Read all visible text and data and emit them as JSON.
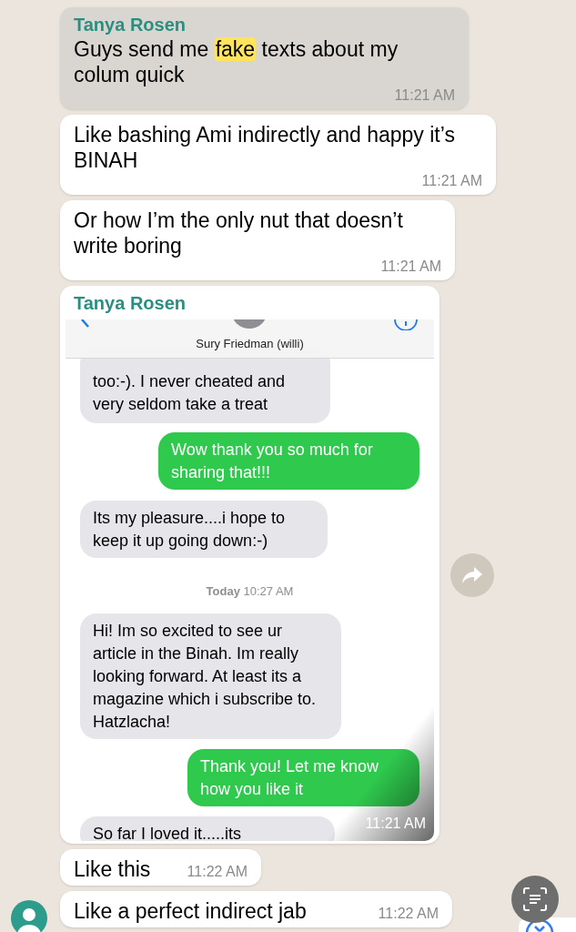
{
  "messages": [
    {
      "kind": "text",
      "selected": true,
      "sender": "Tanya Rosen",
      "parts": [
        {
          "text": "Guys send me ",
          "highlighted": false
        },
        {
          "text": "fake",
          "highlighted": true
        },
        {
          "text": " texts about my colum quick",
          "highlighted": false
        }
      ],
      "time": "11:21 AM"
    },
    {
      "kind": "text",
      "selected": false,
      "parts": [
        {
          "text": "Like bashing Ami indirectly and happy it’s BINAH",
          "highlighted": false
        }
      ],
      "time": "11:21 AM"
    },
    {
      "kind": "text",
      "selected": false,
      "parts": [
        {
          "text": "Or how I’m the only nut that doesn’t write boring",
          "highlighted": false
        }
      ],
      "time": "11:21 AM"
    },
    {
      "kind": "image",
      "selected": false,
      "sender": "Tanya Rosen",
      "time": "11:21 AM",
      "screenshot": {
        "contact": "Sury Friedman (willi)",
        "items": [
          {
            "kind": "received",
            "text": "too:-). I never cheated and very seldom take a treat"
          },
          {
            "kind": "sent",
            "text": "Wow thank you so much for sharing that!!!"
          },
          {
            "kind": "received",
            "text": "Its my pleasure....i hope to keep it up going down:-)"
          },
          {
            "kind": "date",
            "text": "**Today** 10:27 AM"
          },
          {
            "kind": "received",
            "text": "Hi! Im so excited to see ur article in the Binah. Im really looking forward. At least its a magazine which i subscribe to. Hatzlacha!"
          },
          {
            "kind": "sent",
            "text": "Thank you! Let me know how you like it"
          },
          {
            "kind": "received",
            "text": "So far I loved it.....its"
          }
        ]
      }
    },
    {
      "kind": "text",
      "selected": false,
      "parts": [
        {
          "text": "Like this",
          "highlighted": false
        }
      ],
      "time": "11:22 AM"
    },
    {
      "kind": "text",
      "selected": false,
      "avatar": true,
      "parts": [
        {
          "text": "Like a perfect indirect jab",
          "highlighted": false
        }
      ],
      "time": "11:22 AM"
    }
  ]
}
